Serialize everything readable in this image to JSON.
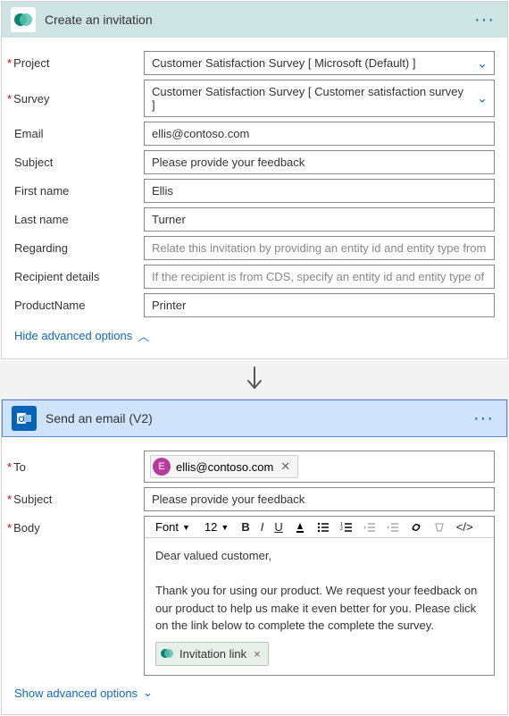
{
  "card1": {
    "title": "Create an invitation",
    "app_icon_name": "forms-pro-icon",
    "fields": {
      "project_label": "Project",
      "project_value": "Customer Satisfaction Survey [ Microsoft (Default) ]",
      "survey_label": "Survey",
      "survey_value": "Customer Satisfaction Survey [ Customer satisfaction survey ]",
      "email_label": "Email",
      "email_value": "ellis@contoso.com",
      "subject_label": "Subject",
      "subject_value": "Please provide your feedback",
      "firstname_label": "First name",
      "firstname_value": "Ellis",
      "lastname_label": "Last name",
      "lastname_value": "Turner",
      "regarding_label": "Regarding",
      "regarding_placeholder": "Relate this invitation by providing an entity id and entity type from this CDS in t",
      "recipient_label": "Recipient details",
      "recipient_placeholder": "If the recipient is from CDS, specify an entity id and entity type of the recipient t",
      "productname_label": "ProductName",
      "productname_value": "Printer"
    },
    "adv_link": "Hide advanced options"
  },
  "card2": {
    "title": "Send an email (V2)",
    "app_icon_name": "outlook-icon",
    "to_label": "To",
    "to_chip_initial": "E",
    "to_chip_text": "ellis@contoso.com",
    "subject_label": "Subject",
    "subject_value": "Please provide your feedback",
    "body_label": "Body",
    "toolbar": {
      "font_label": "Font",
      "size_label": "12"
    },
    "body_greeting": "Dear valued customer,",
    "body_para": "Thank you for using our product. We request your feedback on our product to help us make it even better for you. Please click on the link below to complete the complete the survey.",
    "token_label": "Invitation link",
    "adv_link": "Show advanced options"
  }
}
